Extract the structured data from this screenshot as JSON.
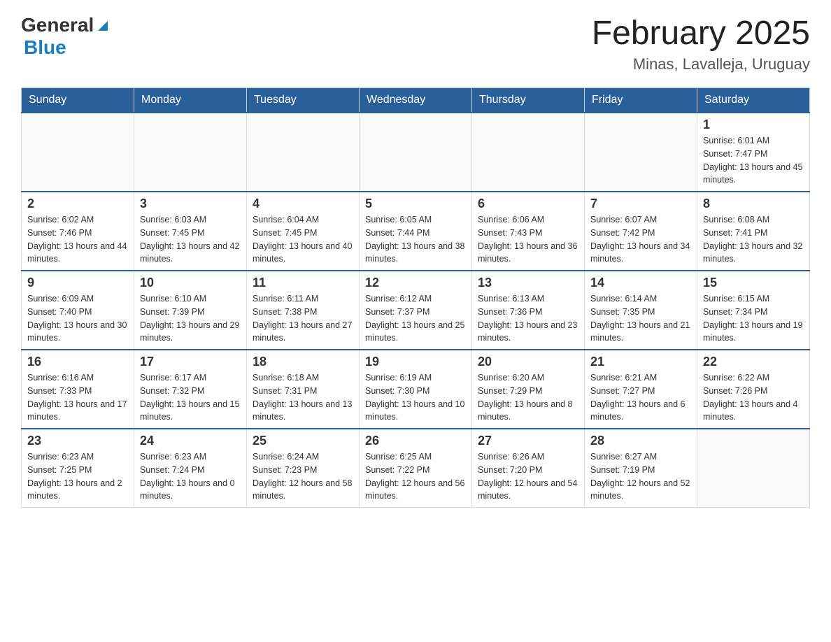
{
  "header": {
    "logo_general": "General",
    "logo_blue": "Blue",
    "month_title": "February 2025",
    "location": "Minas, Lavalleja, Uruguay"
  },
  "weekdays": [
    "Sunday",
    "Monday",
    "Tuesday",
    "Wednesday",
    "Thursday",
    "Friday",
    "Saturday"
  ],
  "weeks": [
    [
      {
        "day": "",
        "sunrise": "",
        "sunset": "",
        "daylight": ""
      },
      {
        "day": "",
        "sunrise": "",
        "sunset": "",
        "daylight": ""
      },
      {
        "day": "",
        "sunrise": "",
        "sunset": "",
        "daylight": ""
      },
      {
        "day": "",
        "sunrise": "",
        "sunset": "",
        "daylight": ""
      },
      {
        "day": "",
        "sunrise": "",
        "sunset": "",
        "daylight": ""
      },
      {
        "day": "",
        "sunrise": "",
        "sunset": "",
        "daylight": ""
      },
      {
        "day": "1",
        "sunrise": "Sunrise: 6:01 AM",
        "sunset": "Sunset: 7:47 PM",
        "daylight": "Daylight: 13 hours and 45 minutes."
      }
    ],
    [
      {
        "day": "2",
        "sunrise": "Sunrise: 6:02 AM",
        "sunset": "Sunset: 7:46 PM",
        "daylight": "Daylight: 13 hours and 44 minutes."
      },
      {
        "day": "3",
        "sunrise": "Sunrise: 6:03 AM",
        "sunset": "Sunset: 7:45 PM",
        "daylight": "Daylight: 13 hours and 42 minutes."
      },
      {
        "day": "4",
        "sunrise": "Sunrise: 6:04 AM",
        "sunset": "Sunset: 7:45 PM",
        "daylight": "Daylight: 13 hours and 40 minutes."
      },
      {
        "day": "5",
        "sunrise": "Sunrise: 6:05 AM",
        "sunset": "Sunset: 7:44 PM",
        "daylight": "Daylight: 13 hours and 38 minutes."
      },
      {
        "day": "6",
        "sunrise": "Sunrise: 6:06 AM",
        "sunset": "Sunset: 7:43 PM",
        "daylight": "Daylight: 13 hours and 36 minutes."
      },
      {
        "day": "7",
        "sunrise": "Sunrise: 6:07 AM",
        "sunset": "Sunset: 7:42 PM",
        "daylight": "Daylight: 13 hours and 34 minutes."
      },
      {
        "day": "8",
        "sunrise": "Sunrise: 6:08 AM",
        "sunset": "Sunset: 7:41 PM",
        "daylight": "Daylight: 13 hours and 32 minutes."
      }
    ],
    [
      {
        "day": "9",
        "sunrise": "Sunrise: 6:09 AM",
        "sunset": "Sunset: 7:40 PM",
        "daylight": "Daylight: 13 hours and 30 minutes."
      },
      {
        "day": "10",
        "sunrise": "Sunrise: 6:10 AM",
        "sunset": "Sunset: 7:39 PM",
        "daylight": "Daylight: 13 hours and 29 minutes."
      },
      {
        "day": "11",
        "sunrise": "Sunrise: 6:11 AM",
        "sunset": "Sunset: 7:38 PM",
        "daylight": "Daylight: 13 hours and 27 minutes."
      },
      {
        "day": "12",
        "sunrise": "Sunrise: 6:12 AM",
        "sunset": "Sunset: 7:37 PM",
        "daylight": "Daylight: 13 hours and 25 minutes."
      },
      {
        "day": "13",
        "sunrise": "Sunrise: 6:13 AM",
        "sunset": "Sunset: 7:36 PM",
        "daylight": "Daylight: 13 hours and 23 minutes."
      },
      {
        "day": "14",
        "sunrise": "Sunrise: 6:14 AM",
        "sunset": "Sunset: 7:35 PM",
        "daylight": "Daylight: 13 hours and 21 minutes."
      },
      {
        "day": "15",
        "sunrise": "Sunrise: 6:15 AM",
        "sunset": "Sunset: 7:34 PM",
        "daylight": "Daylight: 13 hours and 19 minutes."
      }
    ],
    [
      {
        "day": "16",
        "sunrise": "Sunrise: 6:16 AM",
        "sunset": "Sunset: 7:33 PM",
        "daylight": "Daylight: 13 hours and 17 minutes."
      },
      {
        "day": "17",
        "sunrise": "Sunrise: 6:17 AM",
        "sunset": "Sunset: 7:32 PM",
        "daylight": "Daylight: 13 hours and 15 minutes."
      },
      {
        "day": "18",
        "sunrise": "Sunrise: 6:18 AM",
        "sunset": "Sunset: 7:31 PM",
        "daylight": "Daylight: 13 hours and 13 minutes."
      },
      {
        "day": "19",
        "sunrise": "Sunrise: 6:19 AM",
        "sunset": "Sunset: 7:30 PM",
        "daylight": "Daylight: 13 hours and 10 minutes."
      },
      {
        "day": "20",
        "sunrise": "Sunrise: 6:20 AM",
        "sunset": "Sunset: 7:29 PM",
        "daylight": "Daylight: 13 hours and 8 minutes."
      },
      {
        "day": "21",
        "sunrise": "Sunrise: 6:21 AM",
        "sunset": "Sunset: 7:27 PM",
        "daylight": "Daylight: 13 hours and 6 minutes."
      },
      {
        "day": "22",
        "sunrise": "Sunrise: 6:22 AM",
        "sunset": "Sunset: 7:26 PM",
        "daylight": "Daylight: 13 hours and 4 minutes."
      }
    ],
    [
      {
        "day": "23",
        "sunrise": "Sunrise: 6:23 AM",
        "sunset": "Sunset: 7:25 PM",
        "daylight": "Daylight: 13 hours and 2 minutes."
      },
      {
        "day": "24",
        "sunrise": "Sunrise: 6:23 AM",
        "sunset": "Sunset: 7:24 PM",
        "daylight": "Daylight: 13 hours and 0 minutes."
      },
      {
        "day": "25",
        "sunrise": "Sunrise: 6:24 AM",
        "sunset": "Sunset: 7:23 PM",
        "daylight": "Daylight: 12 hours and 58 minutes."
      },
      {
        "day": "26",
        "sunrise": "Sunrise: 6:25 AM",
        "sunset": "Sunset: 7:22 PM",
        "daylight": "Daylight: 12 hours and 56 minutes."
      },
      {
        "day": "27",
        "sunrise": "Sunrise: 6:26 AM",
        "sunset": "Sunset: 7:20 PM",
        "daylight": "Daylight: 12 hours and 54 minutes."
      },
      {
        "day": "28",
        "sunrise": "Sunrise: 6:27 AM",
        "sunset": "Sunset: 7:19 PM",
        "daylight": "Daylight: 12 hours and 52 minutes."
      },
      {
        "day": "",
        "sunrise": "",
        "sunset": "",
        "daylight": ""
      }
    ]
  ]
}
